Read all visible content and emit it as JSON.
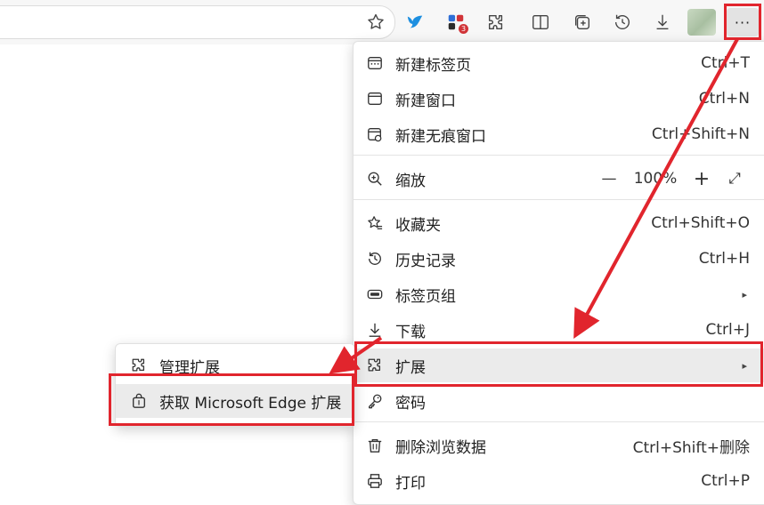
{
  "toolbar": {
    "extension_badge": "3",
    "icons": [
      "star-icon",
      "bird-extension-icon",
      "apps-extension-icon",
      "puzzle-icon",
      "split-screen-icon",
      "collections-icon",
      "history-icon",
      "download-icon",
      "avatar",
      "more-icon"
    ],
    "more_label": "···"
  },
  "menu": {
    "items": [
      {
        "label": "新建标签页",
        "shortcut": "Ctrl+T",
        "icon": "new-tab-icon"
      },
      {
        "label": "新建窗口",
        "shortcut": "Ctrl+N",
        "icon": "new-window-icon"
      },
      {
        "label": "新建无痕窗口",
        "shortcut": "Ctrl+Shift+N",
        "icon": "inprivate-icon"
      },
      {
        "label": "缩放",
        "icon": "zoom-icon",
        "zoom": {
          "minus": "—",
          "value": "100%",
          "plus": "+",
          "expand": "⤢"
        }
      },
      {
        "label": "收藏夹",
        "shortcut": "Ctrl+Shift+O",
        "icon": "favorites-icon"
      },
      {
        "label": "历史记录",
        "shortcut": "Ctrl+H",
        "icon": "history-icon"
      },
      {
        "label": "标签页组",
        "icon": "tab-groups-icon",
        "submenu_arrow": "▸"
      },
      {
        "label": "下载",
        "shortcut": "Ctrl+J",
        "icon": "download-icon"
      },
      {
        "label": "扩展",
        "icon": "extensions-icon",
        "submenu_arrow": "▸",
        "highlighted": true
      },
      {
        "label": "密码",
        "icon": "key-icon"
      },
      {
        "label": "删除浏览数据",
        "shortcut": "Ctrl+Shift+删除",
        "icon": "trash-icon"
      },
      {
        "label": "打印",
        "shortcut": "Ctrl+P",
        "icon": "print-icon"
      }
    ]
  },
  "submenu": {
    "items": [
      {
        "label": "管理扩展",
        "icon": "puzzle-icon"
      },
      {
        "label": "获取 Microsoft Edge 扩展",
        "icon": "shopping-bag-icon",
        "highlighted": true
      }
    ]
  },
  "colors": {
    "annotation": "#e1252d",
    "highlight": "#ebebeb",
    "badge": "#d13438",
    "bird": "#1d8fe0"
  }
}
